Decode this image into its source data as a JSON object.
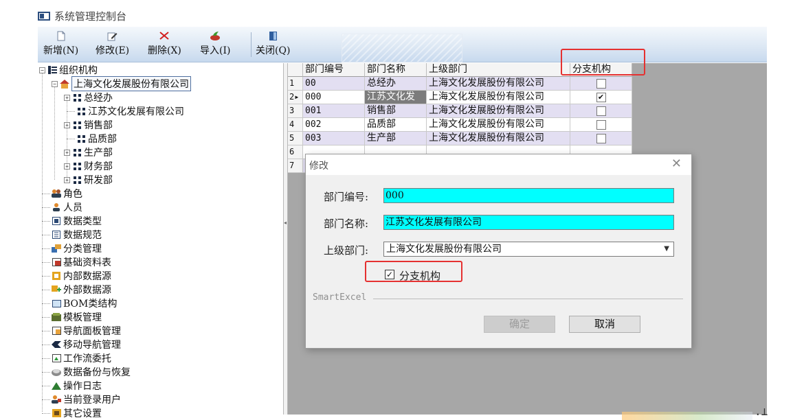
{
  "window": {
    "title": "系统管理控制台"
  },
  "toolbar": {
    "buttons": [
      {
        "label": "新增(N)",
        "icon": "new-file-icon"
      },
      {
        "label": "修改(E)",
        "icon": "edit-icon"
      },
      {
        "label": "删除(X)",
        "icon": "delete-icon"
      },
      {
        "label": "导入(I)",
        "icon": "import-icon"
      },
      {
        "label": "关闭(Q)",
        "icon": "close-door-icon"
      }
    ]
  },
  "tree": {
    "root": "组织机构",
    "company": "上海文化发展股份有限公司",
    "departments": [
      "总经办",
      "江苏文化发展有限公司",
      "销售部",
      "品质部",
      "生产部",
      "财务部",
      "研发部"
    ],
    "items": [
      "角色",
      "人员",
      "数据类型",
      "数据规范",
      "分类管理",
      "基础资料表",
      "内部数据源",
      "外部数据源",
      "BOM类结构",
      "模板管理",
      "导航面板管理",
      "移动导航管理",
      "工作流委托",
      "数据备份与恢复",
      "操作日志",
      "当前登录用户",
      "其它设置"
    ]
  },
  "grid": {
    "columns": [
      "部门编号",
      "部门名称",
      "上级部门",
      "分支机构"
    ],
    "rows": [
      {
        "num": "1",
        "code": "00",
        "name": "总经办",
        "parent": "上海文化发展股份有限公司",
        "branch": false
      },
      {
        "num": "2▸",
        "code": "000",
        "name": "江苏文化发",
        "parent": "上海文化发展股份有限公司",
        "branch": true
      },
      {
        "num": "3",
        "code": "001",
        "name": "销售部",
        "parent": "上海文化发展股份有限公司",
        "branch": false
      },
      {
        "num": "4",
        "code": "002",
        "name": "品质部",
        "parent": "上海文化发展股份有限公司",
        "branch": false
      },
      {
        "num": "5",
        "code": "003",
        "name": "生产部",
        "parent": "上海文化发展股份有限公司",
        "branch": false
      },
      {
        "num": "6",
        "code": "",
        "name": "",
        "parent": "",
        "branch": false
      },
      {
        "num": "7",
        "code": "",
        "name": "",
        "parent": "",
        "branch": false
      }
    ]
  },
  "dialog": {
    "title": "修改",
    "code_label": "部门编号:",
    "code_value": "000",
    "name_label": "部门名称:",
    "name_value": "江苏文化发展有限公司",
    "parent_label": "上级部门:",
    "parent_value": "上海文化发展股份有限公司",
    "branch_label": "分支机构",
    "branch_checked": true,
    "group_label": "SmartExcel",
    "ok_label": "确定",
    "cancel_label": "取消"
  },
  "colors": {
    "highlight": "#e53030",
    "input_bg": "#00ffff",
    "row_alt": "#e3dff2"
  }
}
